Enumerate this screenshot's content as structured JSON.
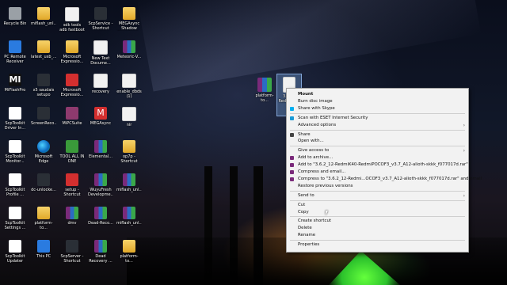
{
  "desktop": {
    "icons": [
      {
        "label": "Recycle Bin",
        "icon": "recycle-bin-icon",
        "style": "gray"
      },
      {
        "label": "miflash_unl...",
        "icon": "folder-icon",
        "style": "folder"
      },
      {
        "label": "sdk tools adb fastboot",
        "icon": "document-icon",
        "style": "doc"
      },
      {
        "label": "ScpService - Shortcut",
        "icon": "app-icon",
        "style": "dark"
      },
      {
        "label": "MEGAsync Shadow Download...",
        "icon": "folder-icon",
        "style": "folder"
      },
      {
        "label": "PC Remote Receiver",
        "icon": "remote-icon",
        "style": "blue"
      },
      {
        "label": "latest_usb_...",
        "icon": "folder-icon",
        "style": "folder"
      },
      {
        "label": "Microsoft Expressio...",
        "icon": "folder-icon",
        "style": "folder"
      },
      {
        "label": "New Text Docume...",
        "icon": "document-icon",
        "style": "doc"
      },
      {
        "label": "Meteoric-V...",
        "icon": "archive-icon",
        "style": "rar"
      },
      {
        "label": "MiFlashPro",
        "icon": "xiaomi-icon",
        "style": "xiaomi",
        "glyph": "MI"
      },
      {
        "label": "x5 saudais setupo",
        "icon": "app-icon",
        "style": "dark"
      },
      {
        "label": "Microsoft Expressio...",
        "icon": "app-icon",
        "style": "red"
      },
      {
        "label": "recovery",
        "icon": "document-icon",
        "style": "doc"
      },
      {
        "label": "enable_dbds (1)",
        "icon": "document-icon",
        "style": "doc"
      },
      {
        "label": "ScpToolkit Driver In...",
        "icon": "gamepad-icon",
        "style": "white"
      },
      {
        "label": "ScreenReco...",
        "icon": "app-icon",
        "style": "dark"
      },
      {
        "label": "MiPCSuite",
        "icon": "app-icon",
        "style": "pink"
      },
      {
        "label": "MEGAsync",
        "icon": "mega-icon",
        "style": "red",
        "glyph": "M"
      },
      {
        "label": "nir",
        "icon": "document-icon",
        "style": "doc"
      },
      {
        "label": "ScpToolkit Monitor...",
        "icon": "gamepad-icon",
        "style": "white"
      },
      {
        "label": "Microsoft Edge",
        "icon": "edge-icon",
        "style": "edge"
      },
      {
        "label": "TOOL ALL IN ONE",
        "icon": "app-icon",
        "style": "green"
      },
      {
        "label": "Elemental...",
        "icon": "archive-icon",
        "style": "rar"
      },
      {
        "label": "op7p - Shortcut",
        "icon": "folder-icon",
        "style": "folder"
      },
      {
        "label": "ScpToolkit Profile ...",
        "icon": "gamepad-icon",
        "style": "white"
      },
      {
        "label": "dc-unlocke...",
        "icon": "app-icon",
        "style": "dark"
      },
      {
        "label": "setup - Shortcut",
        "icon": "app-icon",
        "style": "red"
      },
      {
        "label": "WuyuFresh Developme...",
        "icon": "archive-icon",
        "style": "rar"
      },
      {
        "label": "miflash_unl...",
        "icon": "archive-icon",
        "style": "rar"
      },
      {
        "label": "ScpToolkit Settings ...",
        "icon": "gamepad-icon",
        "style": "white"
      },
      {
        "label": "platform-to...",
        "icon": "folder-icon",
        "style": "folder"
      },
      {
        "label": "dmv",
        "icon": "archive-icon",
        "style": "rar"
      },
      {
        "label": "Dead-Reco...",
        "icon": "archive-icon",
        "style": "rar"
      },
      {
        "label": "miflash_unl...",
        "icon": "archive-icon",
        "style": "rar"
      },
      {
        "label": "ScpToolkit Updater",
        "icon": "gamepad-icon",
        "style": "white"
      },
      {
        "label": "This PC",
        "icon": "computer-icon",
        "style": "blue"
      },
      {
        "label": "ScpServer - Shortcut",
        "icon": "app-icon",
        "style": "dark"
      },
      {
        "label": "Dead Recovery ...",
        "icon": "archive-icon",
        "style": "rar"
      },
      {
        "label": "platform-to...",
        "icon": "folder-icon",
        "style": "folder"
      }
    ],
    "selected_file_1": {
      "label": "platform-to..."
    },
    "selected_file_2": {
      "label": "3.6.2 -Redmi... ..."
    }
  },
  "context_menu": {
    "items": [
      {
        "label": "Mount",
        "bold": true,
        "icon": "",
        "submenu": false
      },
      {
        "label": "Burn disc image",
        "icon": "",
        "submenu": false
      },
      {
        "label": "Share with Skype",
        "icon": "skype-icon",
        "color": "#00aff0",
        "submenu": false
      },
      {
        "sep": true
      },
      {
        "label": "Scan with ESET Internet Security",
        "icon": "eset-icon",
        "color": "#1a9ad6",
        "submenu": false
      },
      {
        "label": "Advanced options",
        "icon": "",
        "submenu": true
      },
      {
        "sep": true
      },
      {
        "label": "Share",
        "icon": "share-icon",
        "color": "#444",
        "submenu": false
      },
      {
        "label": "Open with...",
        "icon": "",
        "submenu": false
      },
      {
        "sep": true
      },
      {
        "label": "Give access to",
        "icon": "",
        "submenu": true
      },
      {
        "label": "Add to archive...",
        "icon": "winrar-icon",
        "color": "#7a2a7a",
        "submenu": false
      },
      {
        "label": "Add to \"3.6.2_12-RedmiK40-RedmiPOCOF3_v3.7_A12-alioth-skkk_f077017d.rar\"",
        "icon": "winrar-icon",
        "color": "#7a2a7a",
        "submenu": false
      },
      {
        "label": "Compress and email...",
        "icon": "winrar-icon",
        "color": "#7a2a7a",
        "submenu": false
      },
      {
        "label": "Compress to \"3.6.2_12-Redmi...OCOF3_v3.7_A12-alioth-skkk_f077017d.rar\" and email",
        "icon": "winrar-icon",
        "color": "#7a2a7a",
        "submenu": false
      },
      {
        "label": "Restore previous versions",
        "icon": "",
        "submenu": false
      },
      {
        "sep": true
      },
      {
        "label": "Send to",
        "icon": "",
        "submenu": true
      },
      {
        "sep": true
      },
      {
        "label": "Cut",
        "icon": "",
        "submenu": false
      },
      {
        "label": "Copy",
        "icon": "",
        "submenu": false
      },
      {
        "sep": true
      },
      {
        "label": "Create shortcut",
        "icon": "",
        "submenu": false
      },
      {
        "label": "Delete",
        "icon": "",
        "submenu": false
      },
      {
        "label": "Rename",
        "icon": "",
        "submenu": false
      },
      {
        "sep": true
      },
      {
        "label": "Properties",
        "icon": "",
        "submenu": false
      }
    ]
  }
}
